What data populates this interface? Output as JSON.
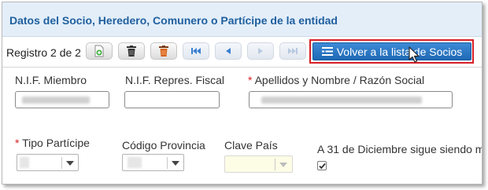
{
  "header": {
    "title": "Datos del Socio, Heredero, Comunero o Partícipe de la entidad"
  },
  "toolbar": {
    "registro_label": "Registro 2 de 2",
    "buttons": [
      {
        "icon": "new-document-icon"
      },
      {
        "icon": "trash-icon"
      },
      {
        "icon": "trash-orange-icon"
      },
      {
        "icon": "first-record-icon"
      },
      {
        "icon": "previous-record-icon"
      },
      {
        "icon": "next-record-icon"
      },
      {
        "icon": "last-record-icon"
      }
    ],
    "volver_label": "Volver a la lista de Socios",
    "highlight_color": "#d71f26"
  },
  "form": {
    "nif_miembro": {
      "label": "N.I.F. Miembro"
    },
    "nif_repres": {
      "label": "N.I.F. Repres. Fiscal"
    },
    "apellidos": {
      "required_mark": "*",
      "label": "Apellidos y Nombre / Razón Social"
    },
    "tipo_participe": {
      "required_mark": "*",
      "label": "Tipo Partícipe"
    },
    "codigo_provincia": {
      "label": "Código Provincia"
    },
    "clave_pais": {
      "label": "Clave País"
    },
    "a31_diciembre": {
      "label": "A 31 de Diciembre sigue siendo m",
      "checked": true
    }
  },
  "colors": {
    "accent": "#1f5f9e",
    "header_bg": "#e3eef9",
    "required": "#d71f26",
    "button_primary": "#2a77c4"
  }
}
